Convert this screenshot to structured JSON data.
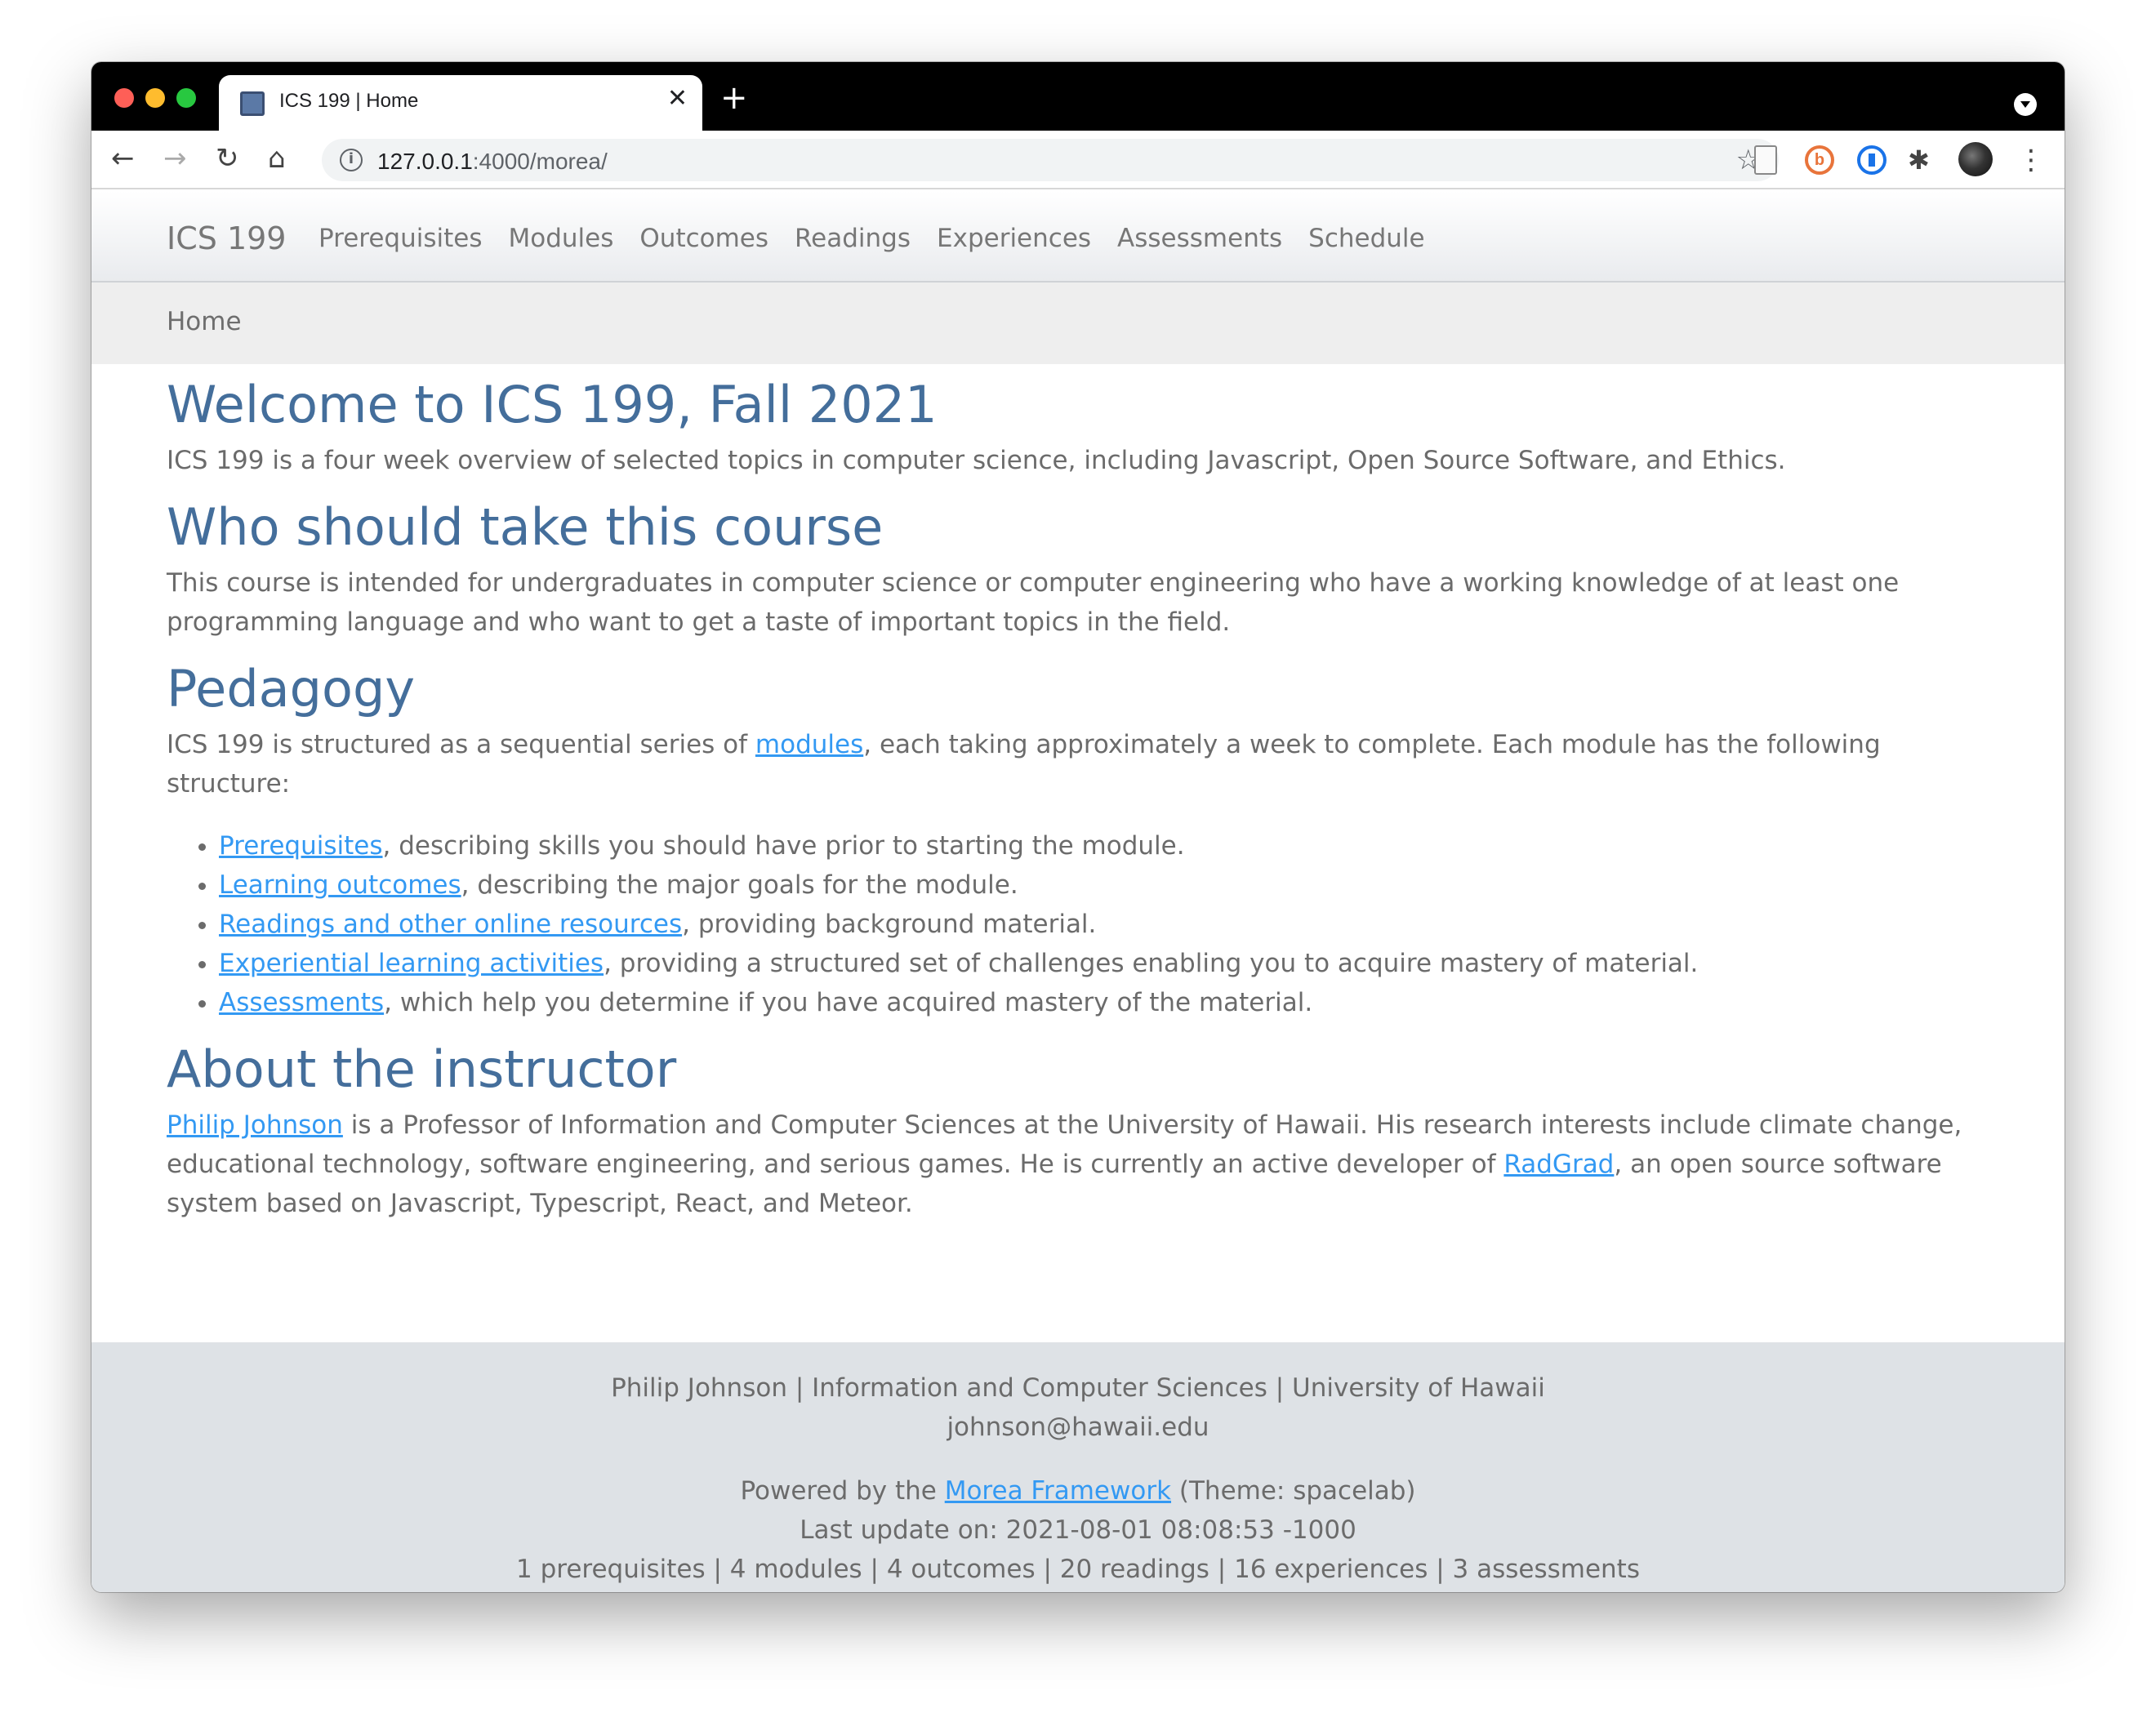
{
  "browser": {
    "tab_title": "ICS 199 | Home",
    "tab_close": "✕",
    "new_tab": "+",
    "url_host": "127.0.0.1",
    "url_rest": ":4000/morea/",
    "info_icon": "i",
    "star_icon": "☆",
    "back_icon": "←",
    "forward_icon": "→",
    "reload_icon": "↻",
    "home_icon": "⌂",
    "bitly_glyph": "b",
    "puzzle_icon": "✱",
    "menu_icon": "⋮"
  },
  "navbar": {
    "brand": "ICS 199",
    "links": [
      "Prerequisites",
      "Modules",
      "Outcomes",
      "Readings",
      "Experiences",
      "Assessments",
      "Schedule"
    ]
  },
  "breadcrumb": "Home",
  "content": {
    "welcome_title": "Welcome to ICS 199, Fall 2021",
    "welcome_text": "ICS 199 is a four week overview of selected topics in computer science, including Javascript, Open Source Software, and Ethics.",
    "who_title": "Who should take this course",
    "who_text": "This course is intended for undergraduates in computer science or computer engineering who have a working knowledge of at least one programming language and who want to get a taste of important topics in the field.",
    "pedagogy_title": "Pedagogy",
    "pedagogy_before": "ICS 199 is structured as a sequential series of ",
    "pedagogy_link": "modules",
    "pedagogy_after": ", each taking approximately a week to complete. Each module has the following structure:",
    "structure": [
      {
        "link": "Prerequisites",
        "text": ", describing skills you should have prior to starting the module."
      },
      {
        "link": "Learning outcomes",
        "text": ", describing the major goals for the module."
      },
      {
        "link": "Readings and other online resources",
        "text": ", providing background material."
      },
      {
        "link": "Experiential learning activities",
        "text": ", providing a structured set of challenges enabling you to acquire mastery of material."
      },
      {
        "link": "Assessments",
        "text": ", which help you determine if you have acquired mastery of the material."
      }
    ],
    "instructor_title": "About the instructor",
    "instructor_link": "Philip Johnson",
    "instructor_mid": " is a Professor of Information and Computer Sciences at the University of Hawaii. His research interests include climate change, educational technology, software engineering, and serious games. He is currently an active developer of ",
    "radgrad_link": "RadGrad",
    "instructor_end": ", an open source software system based on Javascript, Typescript, React, and Meteor."
  },
  "footer": {
    "line1": "Philip Johnson | Information and Computer Sciences | University of Hawaii",
    "email": "johnson@hawaii.edu",
    "powered_before": "Powered by the ",
    "powered_link": "Morea Framework",
    "powered_after": " (Theme: spacelab)",
    "last_update": "Last update on: 2021-08-01 08:08:53 -1000",
    "counts": "1 prerequisites | 4 modules | 4 outcomes | 20 readings | 16 experiences | 3 assessments"
  }
}
